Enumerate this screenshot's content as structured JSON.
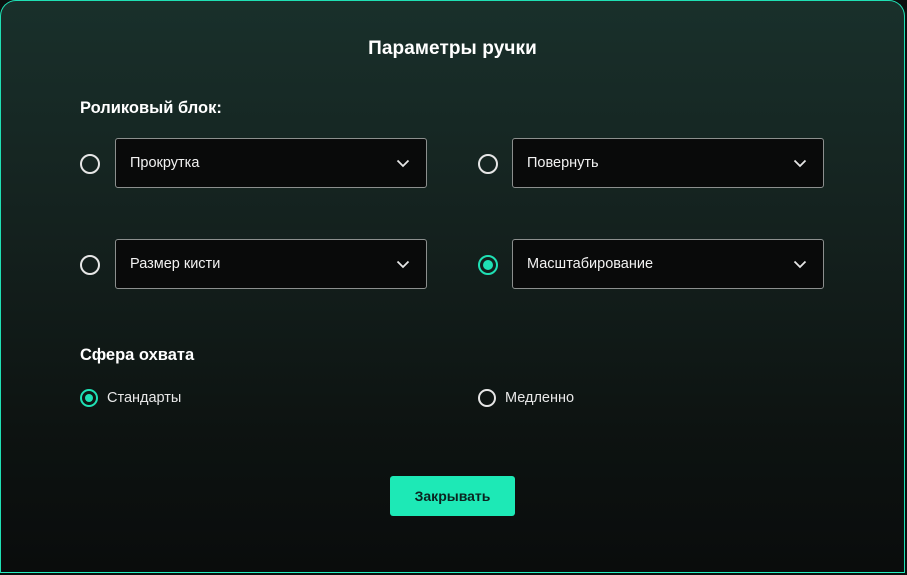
{
  "dialog": {
    "title": "Параметры ручки",
    "accent_color": "#1de9b6"
  },
  "wheel_block": {
    "label": "Роликовый блок:",
    "options": [
      {
        "value": "Прокрутка",
        "selected": false
      },
      {
        "value": "Повернуть",
        "selected": false
      },
      {
        "value": "Размер кисти",
        "selected": false
      },
      {
        "value": "Масштабирование",
        "selected": true
      }
    ]
  },
  "scope": {
    "label": "Сфера охвата",
    "options": [
      {
        "label": "Стандарты",
        "selected": true
      },
      {
        "label": "Медленно",
        "selected": false
      }
    ]
  },
  "actions": {
    "close_label": "Закрывать"
  },
  "icons": {
    "dropdown": "chevron-down-icon"
  }
}
